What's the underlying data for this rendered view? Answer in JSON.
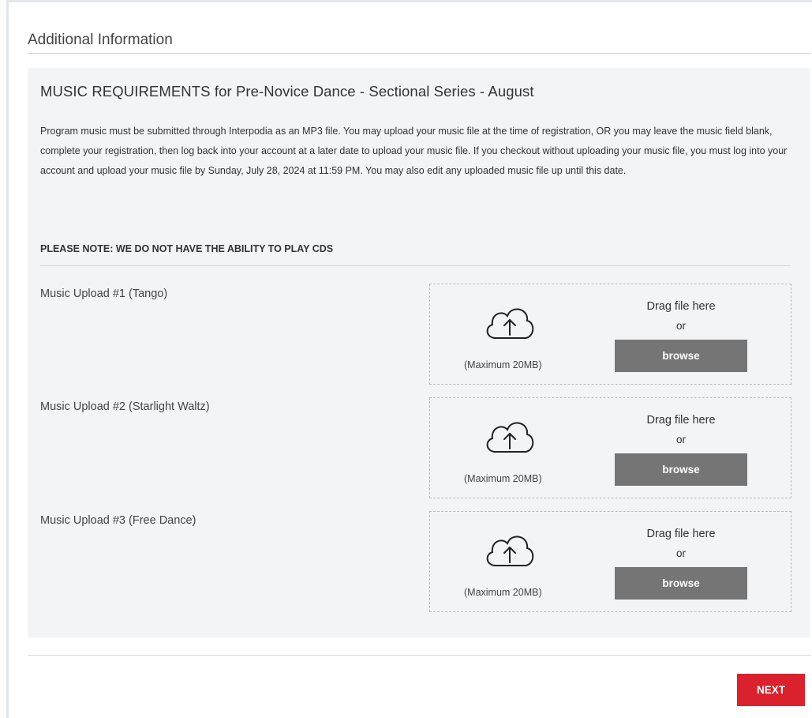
{
  "section": {
    "title": "Additional Information"
  },
  "requirements": {
    "heading": "MUSIC REQUIREMENTS for Pre-Novice Dance - Sectional Series - August",
    "body": "Program music must be submitted through Interpodia as an MP3 file. You may upload your music file at the time of registration, OR you may leave the music field blank, complete your registration, then log back into your account at a later date to upload your music file. If you checkout without uploading your music file, you must log into your account and upload your music file by Sunday, July 28, 2024 at 11:59 PM. You may also edit any uploaded music file up until this date.",
    "note": "PLEASE NOTE: WE DO NOT HAVE THE ABILITY TO PLAY CDS"
  },
  "uploads": [
    {
      "label": "Music Upload #1 (Tango)",
      "max_size": "(Maximum 20MB)",
      "drag_text": "Drag file here",
      "or_text": "or",
      "browse_label": "browse",
      "icon": "cloud-upload-icon"
    },
    {
      "label": "Music Upload #2 (Starlight Waltz)",
      "max_size": "(Maximum 20MB)",
      "drag_text": "Drag file here",
      "or_text": "or",
      "browse_label": "browse",
      "icon": "cloud-upload-icon"
    },
    {
      "label": "Music Upload #3 (Free Dance)",
      "max_size": "(Maximum 20MB)",
      "drag_text": "Drag file here",
      "or_text": "or",
      "browse_label": "browse",
      "icon": "cloud-upload-icon"
    }
  ],
  "footer": {
    "next_label": "NEXT"
  },
  "colors": {
    "panel_bg": "#f3f4f6",
    "browse_button": "#757575",
    "next_button": "#d9222e",
    "border": "#d4d4d4"
  }
}
